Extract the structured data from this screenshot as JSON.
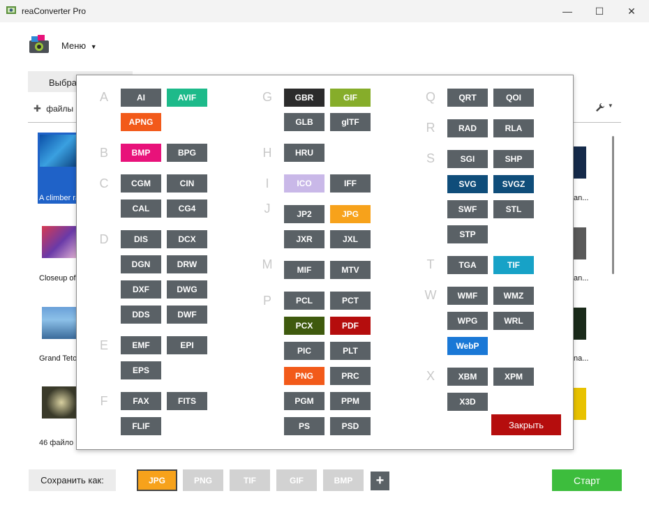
{
  "window": {
    "title": "reaConverter Pro",
    "min_glyph": "—",
    "max_glyph": "☐",
    "close_glyph": "✕"
  },
  "header": {
    "menu_label": "Меню"
  },
  "tabs": {
    "select_label": "Выбра"
  },
  "toolbar": {
    "add_files_label": "файлы",
    "plus_glyph": "✚",
    "settings_glyph": "🔧"
  },
  "files": {
    "left_labels": [
      "A climber ra",
      "Closeup of",
      "Grand Teto",
      ""
    ],
    "right_labels": [
      "an...",
      "an...",
      "na...",
      ""
    ],
    "count_label": "46 файло"
  },
  "popup": {
    "letters": [
      "A",
      "B",
      "C",
      "D",
      "E",
      "F",
      "G",
      "H",
      "I",
      "J",
      "M",
      "P",
      "Q",
      "R",
      "S",
      "T",
      "W",
      "X"
    ],
    "formats": [
      {
        "label": "AI",
        "color": "#5a6166"
      },
      {
        "label": "AVIF",
        "color": "#1dba8a"
      },
      {
        "label": "APNG",
        "color": "#f25a1a"
      },
      {
        "label": "BMP",
        "color": "#e8127a"
      },
      {
        "label": "BPG",
        "color": "#5a6166"
      },
      {
        "label": "CGM",
        "color": "#5a6166"
      },
      {
        "label": "CIN",
        "color": "#5a6166"
      },
      {
        "label": "CAL",
        "color": "#5a6166"
      },
      {
        "label": "CG4",
        "color": "#5a6166"
      },
      {
        "label": "DIS",
        "color": "#5a6166"
      },
      {
        "label": "DCX",
        "color": "#5a6166"
      },
      {
        "label": "DGN",
        "color": "#5a6166"
      },
      {
        "label": "DRW",
        "color": "#5a6166"
      },
      {
        "label": "DXF",
        "color": "#5a6166"
      },
      {
        "label": "DWG",
        "color": "#5a6166"
      },
      {
        "label": "DDS",
        "color": "#5a6166"
      },
      {
        "label": "DWF",
        "color": "#5a6166"
      },
      {
        "label": "EMF",
        "color": "#5a6166"
      },
      {
        "label": "EPI",
        "color": "#5a6166"
      },
      {
        "label": "EPS",
        "color": "#5a6166"
      },
      {
        "label": "FAX",
        "color": "#5a6166"
      },
      {
        "label": "FITS",
        "color": "#5a6166"
      },
      {
        "label": "FLIF",
        "color": "#5a6166"
      },
      {
        "label": "GBR",
        "color": "#2b2b2b"
      },
      {
        "label": "GIF",
        "color": "#86ad2a"
      },
      {
        "label": "GLB",
        "color": "#5a6166"
      },
      {
        "label": "glTF",
        "color": "#5a6166"
      },
      {
        "label": "HRU",
        "color": "#5a6166"
      },
      {
        "label": "ICO",
        "color": "#c9b8e8"
      },
      {
        "label": "IFF",
        "color": "#5a6166"
      },
      {
        "label": "JP2",
        "color": "#5a6166"
      },
      {
        "label": "JPG",
        "color": "#f7a21b"
      },
      {
        "label": "JXR",
        "color": "#5a6166"
      },
      {
        "label": "JXL",
        "color": "#5a6166"
      },
      {
        "label": "MIF",
        "color": "#5a6166"
      },
      {
        "label": "MTV",
        "color": "#5a6166"
      },
      {
        "label": "PCL",
        "color": "#5a6166"
      },
      {
        "label": "PCT",
        "color": "#5a6166"
      },
      {
        "label": "PCX",
        "color": "#3f5a0e"
      },
      {
        "label": "PDF",
        "color": "#b50d0d"
      },
      {
        "label": "PIC",
        "color": "#5a6166"
      },
      {
        "label": "PLT",
        "color": "#5a6166"
      },
      {
        "label": "PNG",
        "color": "#f25a1a"
      },
      {
        "label": "PRC",
        "color": "#5a6166"
      },
      {
        "label": "PGM",
        "color": "#5a6166"
      },
      {
        "label": "PPM",
        "color": "#5a6166"
      },
      {
        "label": "PS",
        "color": "#5a6166"
      },
      {
        "label": "PSD",
        "color": "#5a6166"
      },
      {
        "label": "QRT",
        "color": "#5a6166"
      },
      {
        "label": "QOI",
        "color": "#5a6166"
      },
      {
        "label": "RAD",
        "color": "#5a6166"
      },
      {
        "label": "RLA",
        "color": "#5a6166"
      },
      {
        "label": "SGI",
        "color": "#5a6166"
      },
      {
        "label": "SHP",
        "color": "#5a6166"
      },
      {
        "label": "SVG",
        "color": "#0f4d7a"
      },
      {
        "label": "SVGZ",
        "color": "#0f4d7a"
      },
      {
        "label": "SWF",
        "color": "#5a6166"
      },
      {
        "label": "STL",
        "color": "#5a6166"
      },
      {
        "label": "STP",
        "color": "#5a6166"
      },
      {
        "label": "TGA",
        "color": "#5a6166"
      },
      {
        "label": "TIF",
        "color": "#17a2c7"
      },
      {
        "label": "WMF",
        "color": "#5a6166"
      },
      {
        "label": "WMZ",
        "color": "#5a6166"
      },
      {
        "label": "WPG",
        "color": "#5a6166"
      },
      {
        "label": "WRL",
        "color": "#5a6166"
      },
      {
        "label": "WebP",
        "color": "#1a78d6"
      },
      {
        "label": "XBM",
        "color": "#5a6166"
      },
      {
        "label": "XPM",
        "color": "#5a6166"
      },
      {
        "label": "X3D",
        "color": "#5a6166"
      }
    ],
    "close_label": "Закрыть"
  },
  "bottom": {
    "save_as_label": "Сохранить как:",
    "quick_formats": [
      {
        "label": "JPG",
        "active": true
      },
      {
        "label": "PNG",
        "active": false
      },
      {
        "label": "TIF",
        "active": false
      },
      {
        "label": "GIF",
        "active": false
      },
      {
        "label": "BMP",
        "active": false
      }
    ],
    "plus_glyph": "+",
    "start_label": "Старт"
  }
}
